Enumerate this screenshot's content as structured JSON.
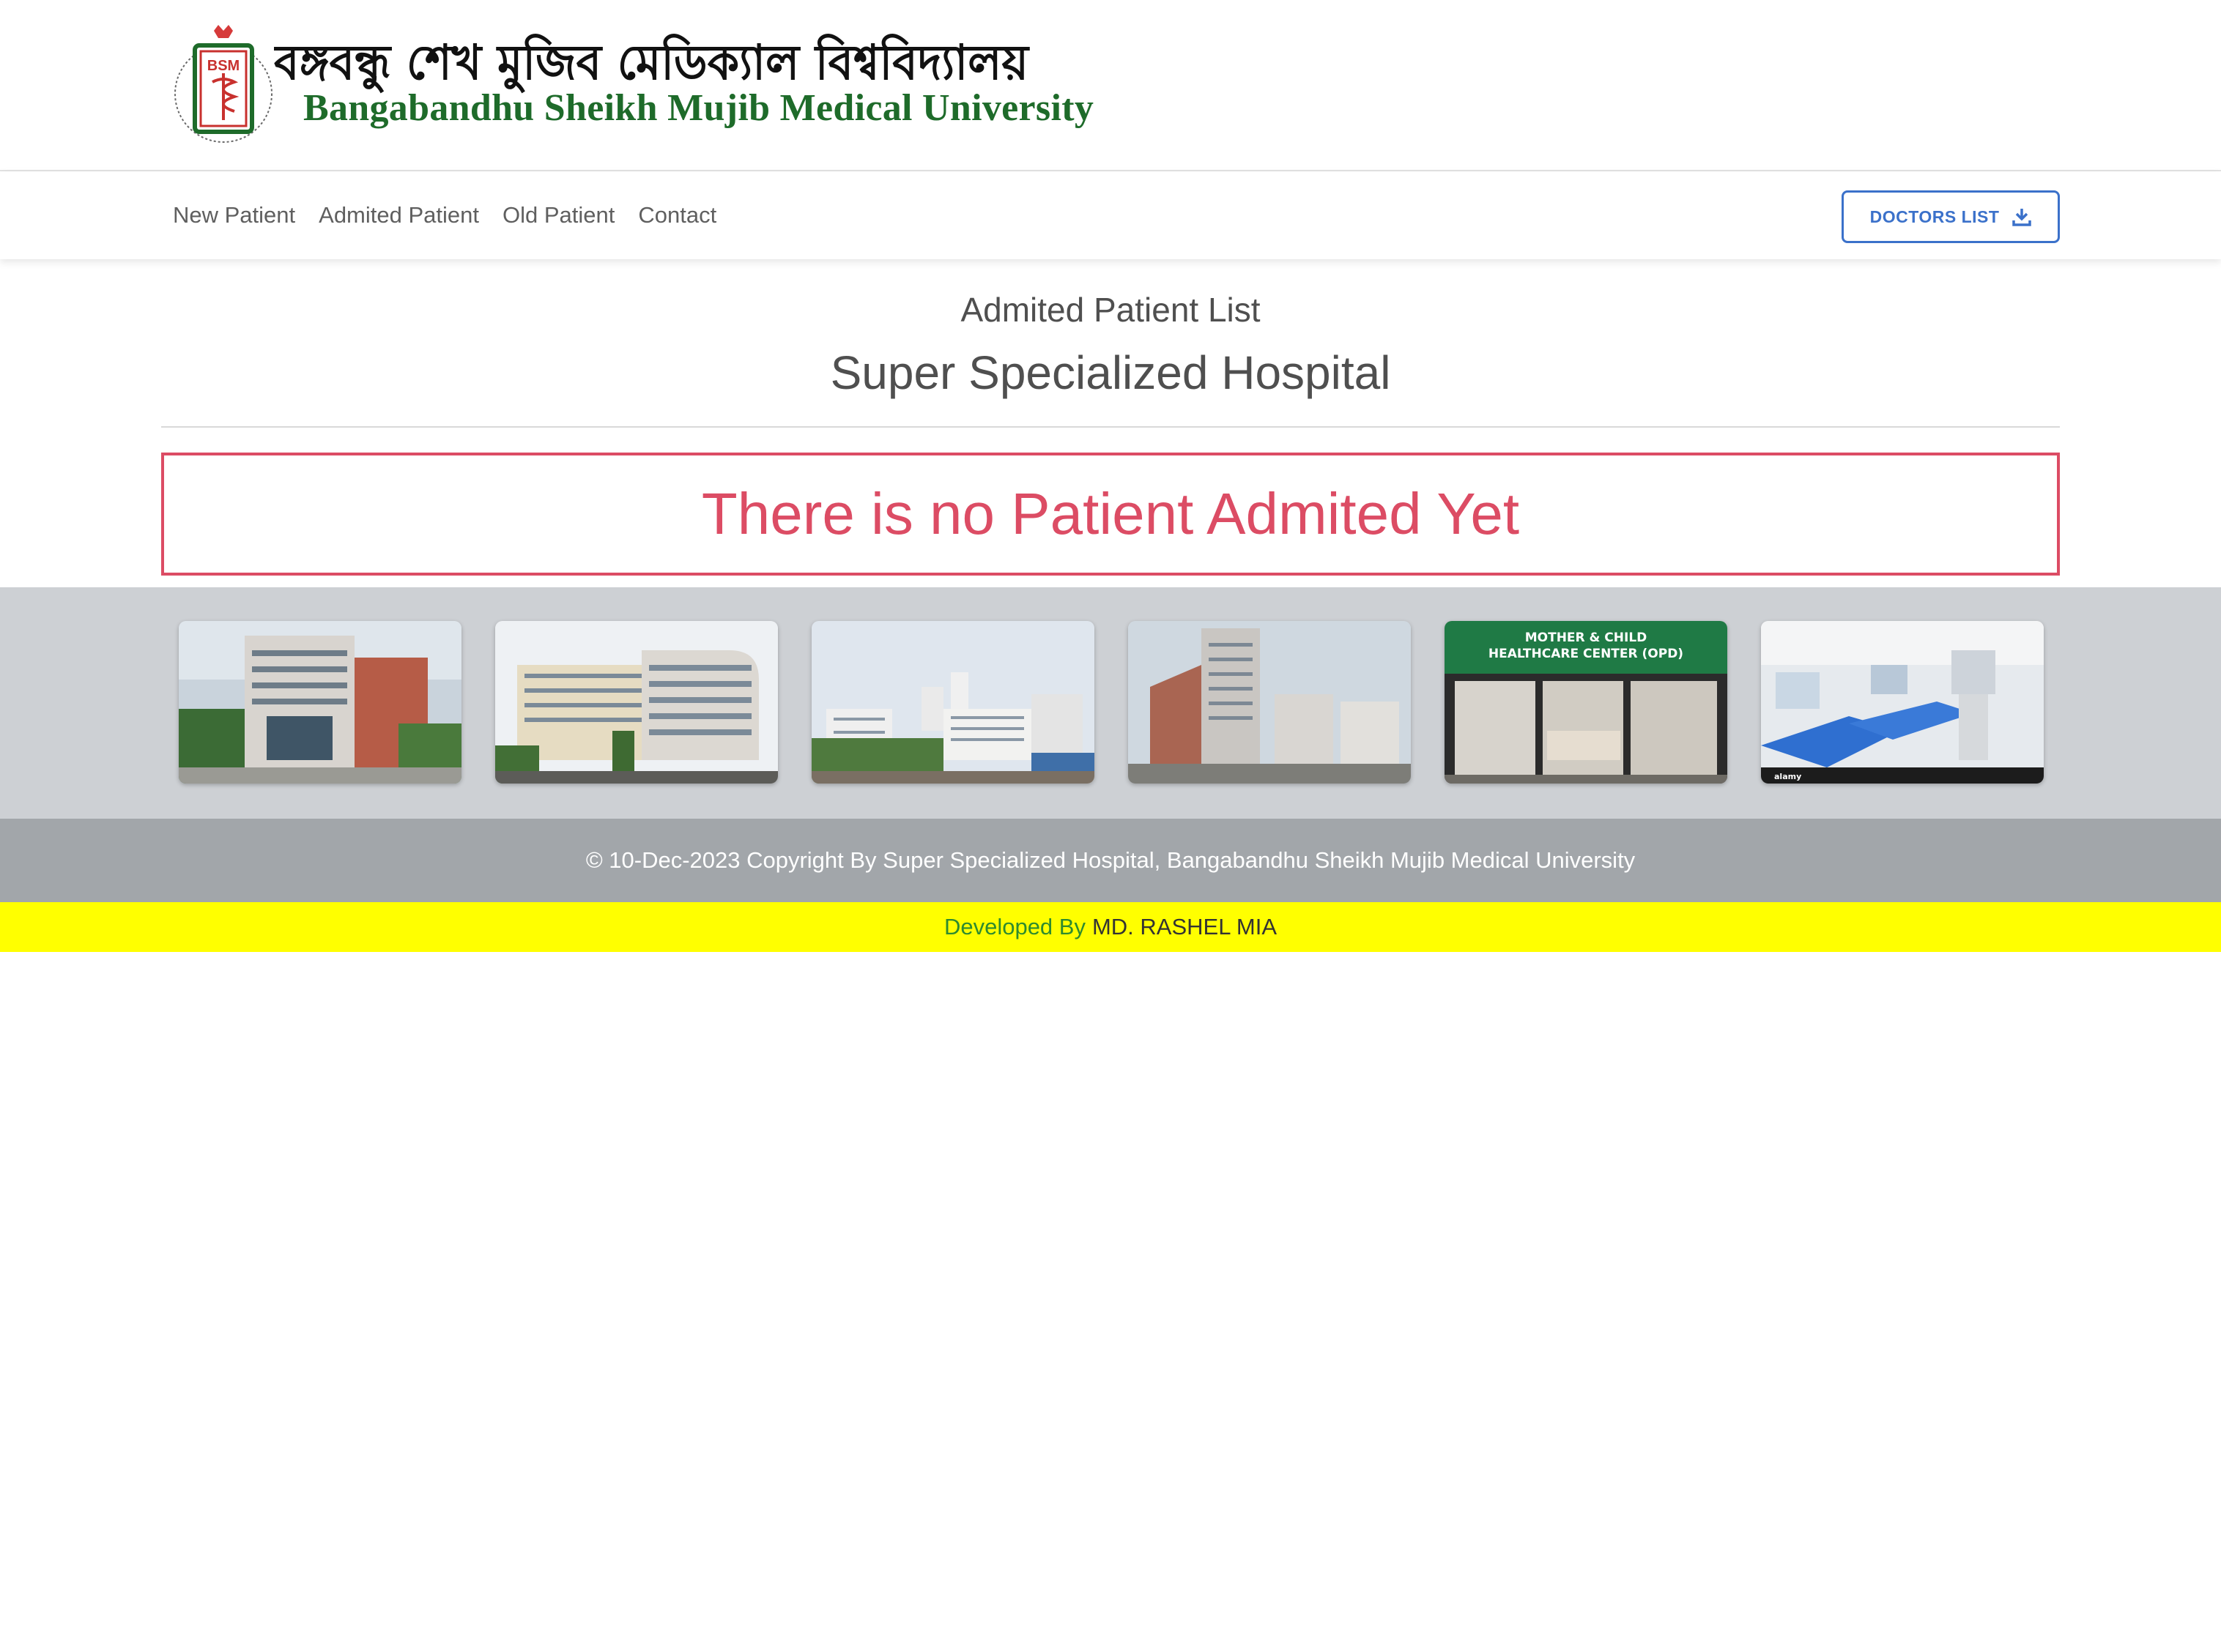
{
  "header": {
    "logo_bn": "বঙ্গবন্ধু শেখ মুজিব মেডিক্যাল বিশ্ববিদ্যালয়",
    "logo_en": "Bangabandhu Sheikh Mujib Medical University",
    "logo_emblem_text": "BSM"
  },
  "nav": {
    "items": [
      {
        "label": "New Patient"
      },
      {
        "label": "Admited Patient"
      },
      {
        "label": "Old Patient"
      },
      {
        "label": "Contact"
      }
    ],
    "doctors_button": "DOCTORS LIST",
    "doctors_button_icon": "download-icon"
  },
  "main": {
    "subtitle": "Admited Patient List",
    "title": "Super Specialized Hospital",
    "empty_message": "There is no Patient Admited Yet"
  },
  "gallery": {
    "images": [
      {
        "name": "hospital-building-front"
      },
      {
        "name": "university-building-curved"
      },
      {
        "name": "campus-skyline"
      },
      {
        "name": "hospital-tower-street"
      },
      {
        "name": "mother-child-healthcare-center",
        "sign_line1": "MOTHER & CHILD",
        "sign_line2": "HEALTHCARE CENTER (OPD)"
      },
      {
        "name": "icu-ward-beds",
        "watermark": "alamy"
      }
    ]
  },
  "footer": {
    "copyright": "© 10-Dec-2023 Copyright By Super Specialized Hospital, Bangabandhu Sheikh Mujib Medical University",
    "developed_by_prefix": "Developed By",
    "developer_name": "MD. RASHEL MIA"
  },
  "colors": {
    "primary": "#3b71ca",
    "danger": "#dc4c64",
    "logo_green": "#1e6b2a",
    "gallery_bg": "#cdd0d4",
    "footer_bg": "#a2a6aa",
    "dev_bar_bg": "#ffff00"
  }
}
